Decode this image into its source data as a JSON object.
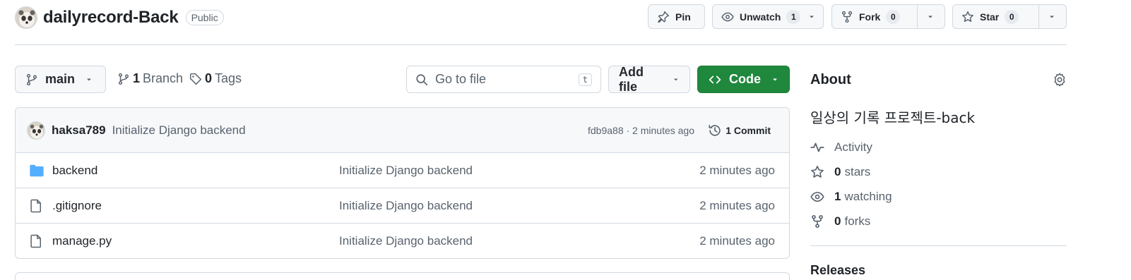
{
  "repo": {
    "name": "dailyrecord-Back",
    "visibility": "Public"
  },
  "actions": {
    "pin": "Pin",
    "watch": {
      "label": "Unwatch",
      "count": "1"
    },
    "fork": {
      "label": "Fork",
      "count": "0"
    },
    "star": {
      "label": "Star",
      "count": "0"
    }
  },
  "toolbar": {
    "branch": "main",
    "branches": {
      "count": "1",
      "label": "Branch"
    },
    "tags": {
      "count": "0",
      "label": "Tags"
    },
    "search_placeholder": "Go to file",
    "search_shortcut": "t",
    "add_file": "Add file",
    "code": "Code"
  },
  "latest_commit": {
    "author": "haksa789",
    "message": "Initialize Django backend",
    "meta": "fdb9a88 · 2 minutes ago",
    "commits": "1 Commit"
  },
  "files": [
    {
      "name": "backend",
      "type": "folder",
      "message": "Initialize Django backend",
      "time": "2 minutes ago"
    },
    {
      "name": ".gitignore",
      "type": "file",
      "message": "Initialize Django backend",
      "time": "2 minutes ago"
    },
    {
      "name": "manage.py",
      "type": "file",
      "message": "Initialize Django backend",
      "time": "2 minutes ago"
    }
  ],
  "about": {
    "title": "About",
    "description": "일상의 기록 프로젝트-back",
    "activity": "Activity",
    "stars": {
      "count": "0",
      "label": "stars"
    },
    "watching": {
      "count": "1",
      "label": "watching"
    },
    "forks": {
      "count": "0",
      "label": "forks"
    }
  },
  "releases_title": "Releases",
  "colors": {
    "accent_green": "#1f883d",
    "folder_blue": "#54aeff",
    "border": "#d1d9e0",
    "muted_text": "#59636e"
  },
  "icons": [
    "repo-avatar-icon",
    "pin-icon",
    "eye-icon",
    "fork-icon",
    "star-icon",
    "chevron-down-icon",
    "branch-icon",
    "tag-icon",
    "search-icon",
    "code-icon",
    "history-icon",
    "folder-icon",
    "file-icon",
    "gear-icon",
    "pulse-icon"
  ]
}
